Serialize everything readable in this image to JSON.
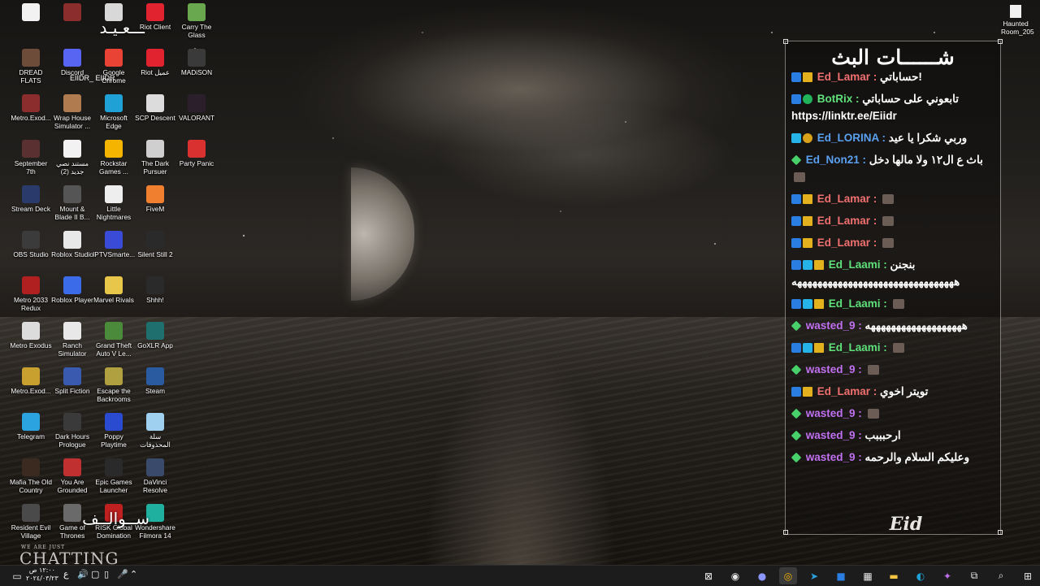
{
  "desktop": {
    "icons": [
      {
        "label": "",
        "col": 0,
        "row": 0,
        "color": "#f2f2f2"
      },
      {
        "label": "",
        "col": 1,
        "row": 0,
        "color": "#8b2d2d"
      },
      {
        "label": "",
        "col": 2,
        "row": 0,
        "color": "#d8d8d8"
      },
      {
        "label": "Riot Client",
        "col": 3,
        "row": 0,
        "color": "#e0232e"
      },
      {
        "label": "Carry The Glass",
        "col": 4,
        "row": 0,
        "color": "#6aa84f"
      },
      {
        "label": "DREAD FLATS",
        "col": 0,
        "row": 1,
        "color": "#6e4c3a"
      },
      {
        "label": "Discord",
        "col": 1,
        "row": 1,
        "color": "#5865f2"
      },
      {
        "label": "Google Chrome",
        "col": 2,
        "row": 1,
        "color": "#e84335"
      },
      {
        "label": "Riot عميل",
        "col": 3,
        "row": 1,
        "color": "#e0232e"
      },
      {
        "label": "MADiSON",
        "col": 4,
        "row": 1,
        "color": "#3a3a3a"
      },
      {
        "label": "Metro.Exod...",
        "col": 0,
        "row": 2,
        "color": "#8b2d2d"
      },
      {
        "label": "Wrap House Simulator ...",
        "col": 1,
        "row": 2,
        "color": "#b07b4f"
      },
      {
        "label": "Microsoft Edge",
        "col": 2,
        "row": 2,
        "color": "#1fa1d6"
      },
      {
        "label": "SCP Descent",
        "col": 3,
        "row": 2,
        "color": "#dcdcdc"
      },
      {
        "label": "VALORANT",
        "col": 4,
        "row": 2,
        "color": "#2a1f2a"
      },
      {
        "label": "September 7th",
        "col": 0,
        "row": 3,
        "color": "#5a3030"
      },
      {
        "label": "مستند نصي جديد (2)",
        "col": 1,
        "row": 3,
        "color": "#f2f2f2"
      },
      {
        "label": "Rockstar Games ...",
        "col": 2,
        "row": 3,
        "color": "#f4b400"
      },
      {
        "label": "The Dark Pursuer",
        "col": 3,
        "row": 3,
        "color": "#cfcfcf"
      },
      {
        "label": "Party Panic",
        "col": 4,
        "row": 3,
        "color": "#d93030"
      },
      {
        "label": "Stream Deck",
        "col": 0,
        "row": 4,
        "color": "#2a3a6a"
      },
      {
        "label": "Mount & Blade II B...",
        "col": 1,
        "row": 4,
        "color": "#555"
      },
      {
        "label": "Little Nightmares",
        "col": 2,
        "row": 4,
        "color": "#eeeeee"
      },
      {
        "label": "FiveM",
        "col": 3,
        "row": 4,
        "color": "#f08030"
      },
      {
        "label": "OBS Studio",
        "col": 0,
        "row": 5,
        "color": "#3b3b3b"
      },
      {
        "label": "Roblox Studio",
        "col": 1,
        "row": 5,
        "color": "#e8e8e8"
      },
      {
        "label": "IPTVSmarte...",
        "col": 2,
        "row": 5,
        "color": "#3a4bd8"
      },
      {
        "label": "Silent Still 2",
        "col": 3,
        "row": 5,
        "color": "#2a2a2a"
      },
      {
        "label": "Metro 2033 Redux",
        "col": 0,
        "row": 6,
        "color": "#b02020"
      },
      {
        "label": "Roblox Player",
        "col": 1,
        "row": 6,
        "color": "#3b6be8"
      },
      {
        "label": "Marvel Rivals",
        "col": 2,
        "row": 6,
        "color": "#e8c64a"
      },
      {
        "label": "Shhh!",
        "col": 3,
        "row": 6,
        "color": "#2a2a2a"
      },
      {
        "label": "Metro Exodus",
        "col": 0,
        "row": 7,
        "color": "#dcdcdc"
      },
      {
        "label": "Ranch Simulator",
        "col": 1,
        "row": 7,
        "color": "#e8e8e8"
      },
      {
        "label": "Grand Theft Auto V Le...",
        "col": 2,
        "row": 7,
        "color": "#4a8a3a"
      },
      {
        "label": "GoXLR App",
        "col": 3,
        "row": 7,
        "color": "#1f6f6f"
      },
      {
        "label": "Metro.Exod...",
        "col": 0,
        "row": 8,
        "color": "#c8a030"
      },
      {
        "label": "Split Fiction",
        "col": 1,
        "row": 8,
        "color": "#3a5ab0"
      },
      {
        "label": "Escape the Backrooms",
        "col": 2,
        "row": 8,
        "color": "#b0a040"
      },
      {
        "label": "Steam",
        "col": 3,
        "row": 8,
        "color": "#2a5aa0"
      },
      {
        "label": "Telegram",
        "col": 0,
        "row": 9,
        "color": "#2aa3e0"
      },
      {
        "label": "Dark Hours Prologue",
        "col": 1,
        "row": 9,
        "color": "#3a3a3a"
      },
      {
        "label": "Poppy Playtime",
        "col": 2,
        "row": 9,
        "color": "#2a4ad0"
      },
      {
        "label": "سلة المحذوفات",
        "col": 3,
        "row": 9,
        "color": "#9fd0f0"
      },
      {
        "label": "Mafia The Old Country",
        "col": 0,
        "row": 10,
        "color": "#3a2a20"
      },
      {
        "label": "You Are Grounded",
        "col": 1,
        "row": 10,
        "color": "#c03030"
      },
      {
        "label": "Epic Games Launcher",
        "col": 2,
        "row": 10,
        "color": "#2a2a2a"
      },
      {
        "label": "DaVinci Resolve",
        "col": 3,
        "row": 10,
        "color": "#3a4a6a"
      },
      {
        "label": "Resident Evil Village",
        "col": 0,
        "row": 11,
        "color": "#4a4a4a"
      },
      {
        "label": "Game of Thrones",
        "col": 1,
        "row": 11,
        "color": "#6a6a6a"
      },
      {
        "label": "RISK Global Domination",
        "col": 2,
        "row": 11,
        "color": "#c02020"
      },
      {
        "label": "Wondershare Filmora 14",
        "col": 3,
        "row": 11,
        "color": "#1fb0a0"
      }
    ],
    "top_right_icon": {
      "label": "Haunted Room_205"
    }
  },
  "overlays": {
    "top_left": "ـــعـيـد",
    "top_left_sub": "EIIDR_ EIIDR",
    "bottom_left": "ســوالــف",
    "bottom_small": "WE ARE JUST",
    "bottom_big": "CHATTING"
  },
  "chat": {
    "title": "شــــــات البث",
    "logo": "Eid",
    "messages": [
      {
        "badges": [
          "blue",
          "crown"
        ],
        "name": "Ed_Lamar",
        "name_color": "#f07070",
        "text": "حساباتي!",
        "emote": false
      },
      {
        "badges": [
          "blue",
          "green"
        ],
        "name": "BotRix",
        "name_color": "#5ee07a",
        "text": "تابعوني على حساباتي https://linktr.ee/Eiidr",
        "emote": false
      },
      {
        "badges": [
          "cyan",
          "gold"
        ],
        "name": "Ed_LORINA",
        "name_color": "#5aa0f0",
        "text": "وربي شكرا يا عيد",
        "emote": false
      },
      {
        "badges": [
          "dia"
        ],
        "name": "Ed_Non21",
        "name_color": "#5aa0f0",
        "text": "باث ع ال١٢ ولا مالها دخل",
        "emote": true
      },
      {
        "badges": [
          "blue",
          "crown"
        ],
        "name": "Ed_Lamar",
        "name_color": "#f07070",
        "text": "",
        "emote": true
      },
      {
        "badges": [
          "blue",
          "crown"
        ],
        "name": "Ed_Lamar",
        "name_color": "#f07070",
        "text": "",
        "emote": true
      },
      {
        "badges": [
          "blue",
          "crown"
        ],
        "name": "Ed_Lamar",
        "name_color": "#f07070",
        "text": "",
        "emote": true
      },
      {
        "badges": [
          "blue",
          "cyan",
          "crown"
        ],
        "name": "Ed_Laami",
        "name_color": "#5ee07a",
        "text": "بنجنن ههههههههههههههههههههههههههههههههه",
        "emote": false
      },
      {
        "badges": [
          "blue",
          "cyan",
          "crown"
        ],
        "name": "Ed_Laami",
        "name_color": "#5ee07a",
        "text": "",
        "emote": true
      },
      {
        "badges": [
          "dia"
        ],
        "name": "wasted_9",
        "name_color": "#c070f0",
        "text": "هههههههههههههههههههه",
        "emote": false
      },
      {
        "badges": [
          "blue",
          "cyan",
          "crown"
        ],
        "name": "Ed_Laami",
        "name_color": "#5ee07a",
        "text": "",
        "emote": true
      },
      {
        "badges": [
          "dia"
        ],
        "name": "wasted_9",
        "name_color": "#c070f0",
        "text": "",
        "emote": true
      },
      {
        "badges": [
          "blue",
          "crown"
        ],
        "name": "Ed_Lamar",
        "name_color": "#f07070",
        "text": "تويتر اخوي",
        "emote": false
      },
      {
        "badges": [
          "dia"
        ],
        "name": "wasted_9",
        "name_color": "#c070f0",
        "text": "",
        "emote": true
      },
      {
        "badges": [
          "dia"
        ],
        "name": "wasted_9",
        "name_color": "#c070f0",
        "text": "ارحبببب",
        "emote": false
      },
      {
        "badges": [
          "dia"
        ],
        "name": "wasted_9",
        "name_color": "#c070f0",
        "text": "وعليكم السلام والرحمه",
        "emote": false
      }
    ]
  },
  "taskbar": {
    "time": "١٢:٠٠ ص",
    "date": "٢٠٢٤/٠٣/٢٣",
    "lang": "ع",
    "apps": [
      "close-icon",
      "obs-icon",
      "discord-icon",
      "chrome-icon",
      "telegram-icon",
      "outlook-icon",
      "calculator-icon",
      "explorer-icon",
      "edge-icon",
      "copilot-icon",
      "taskview-icon",
      "search-icon",
      "start-icon"
    ]
  }
}
